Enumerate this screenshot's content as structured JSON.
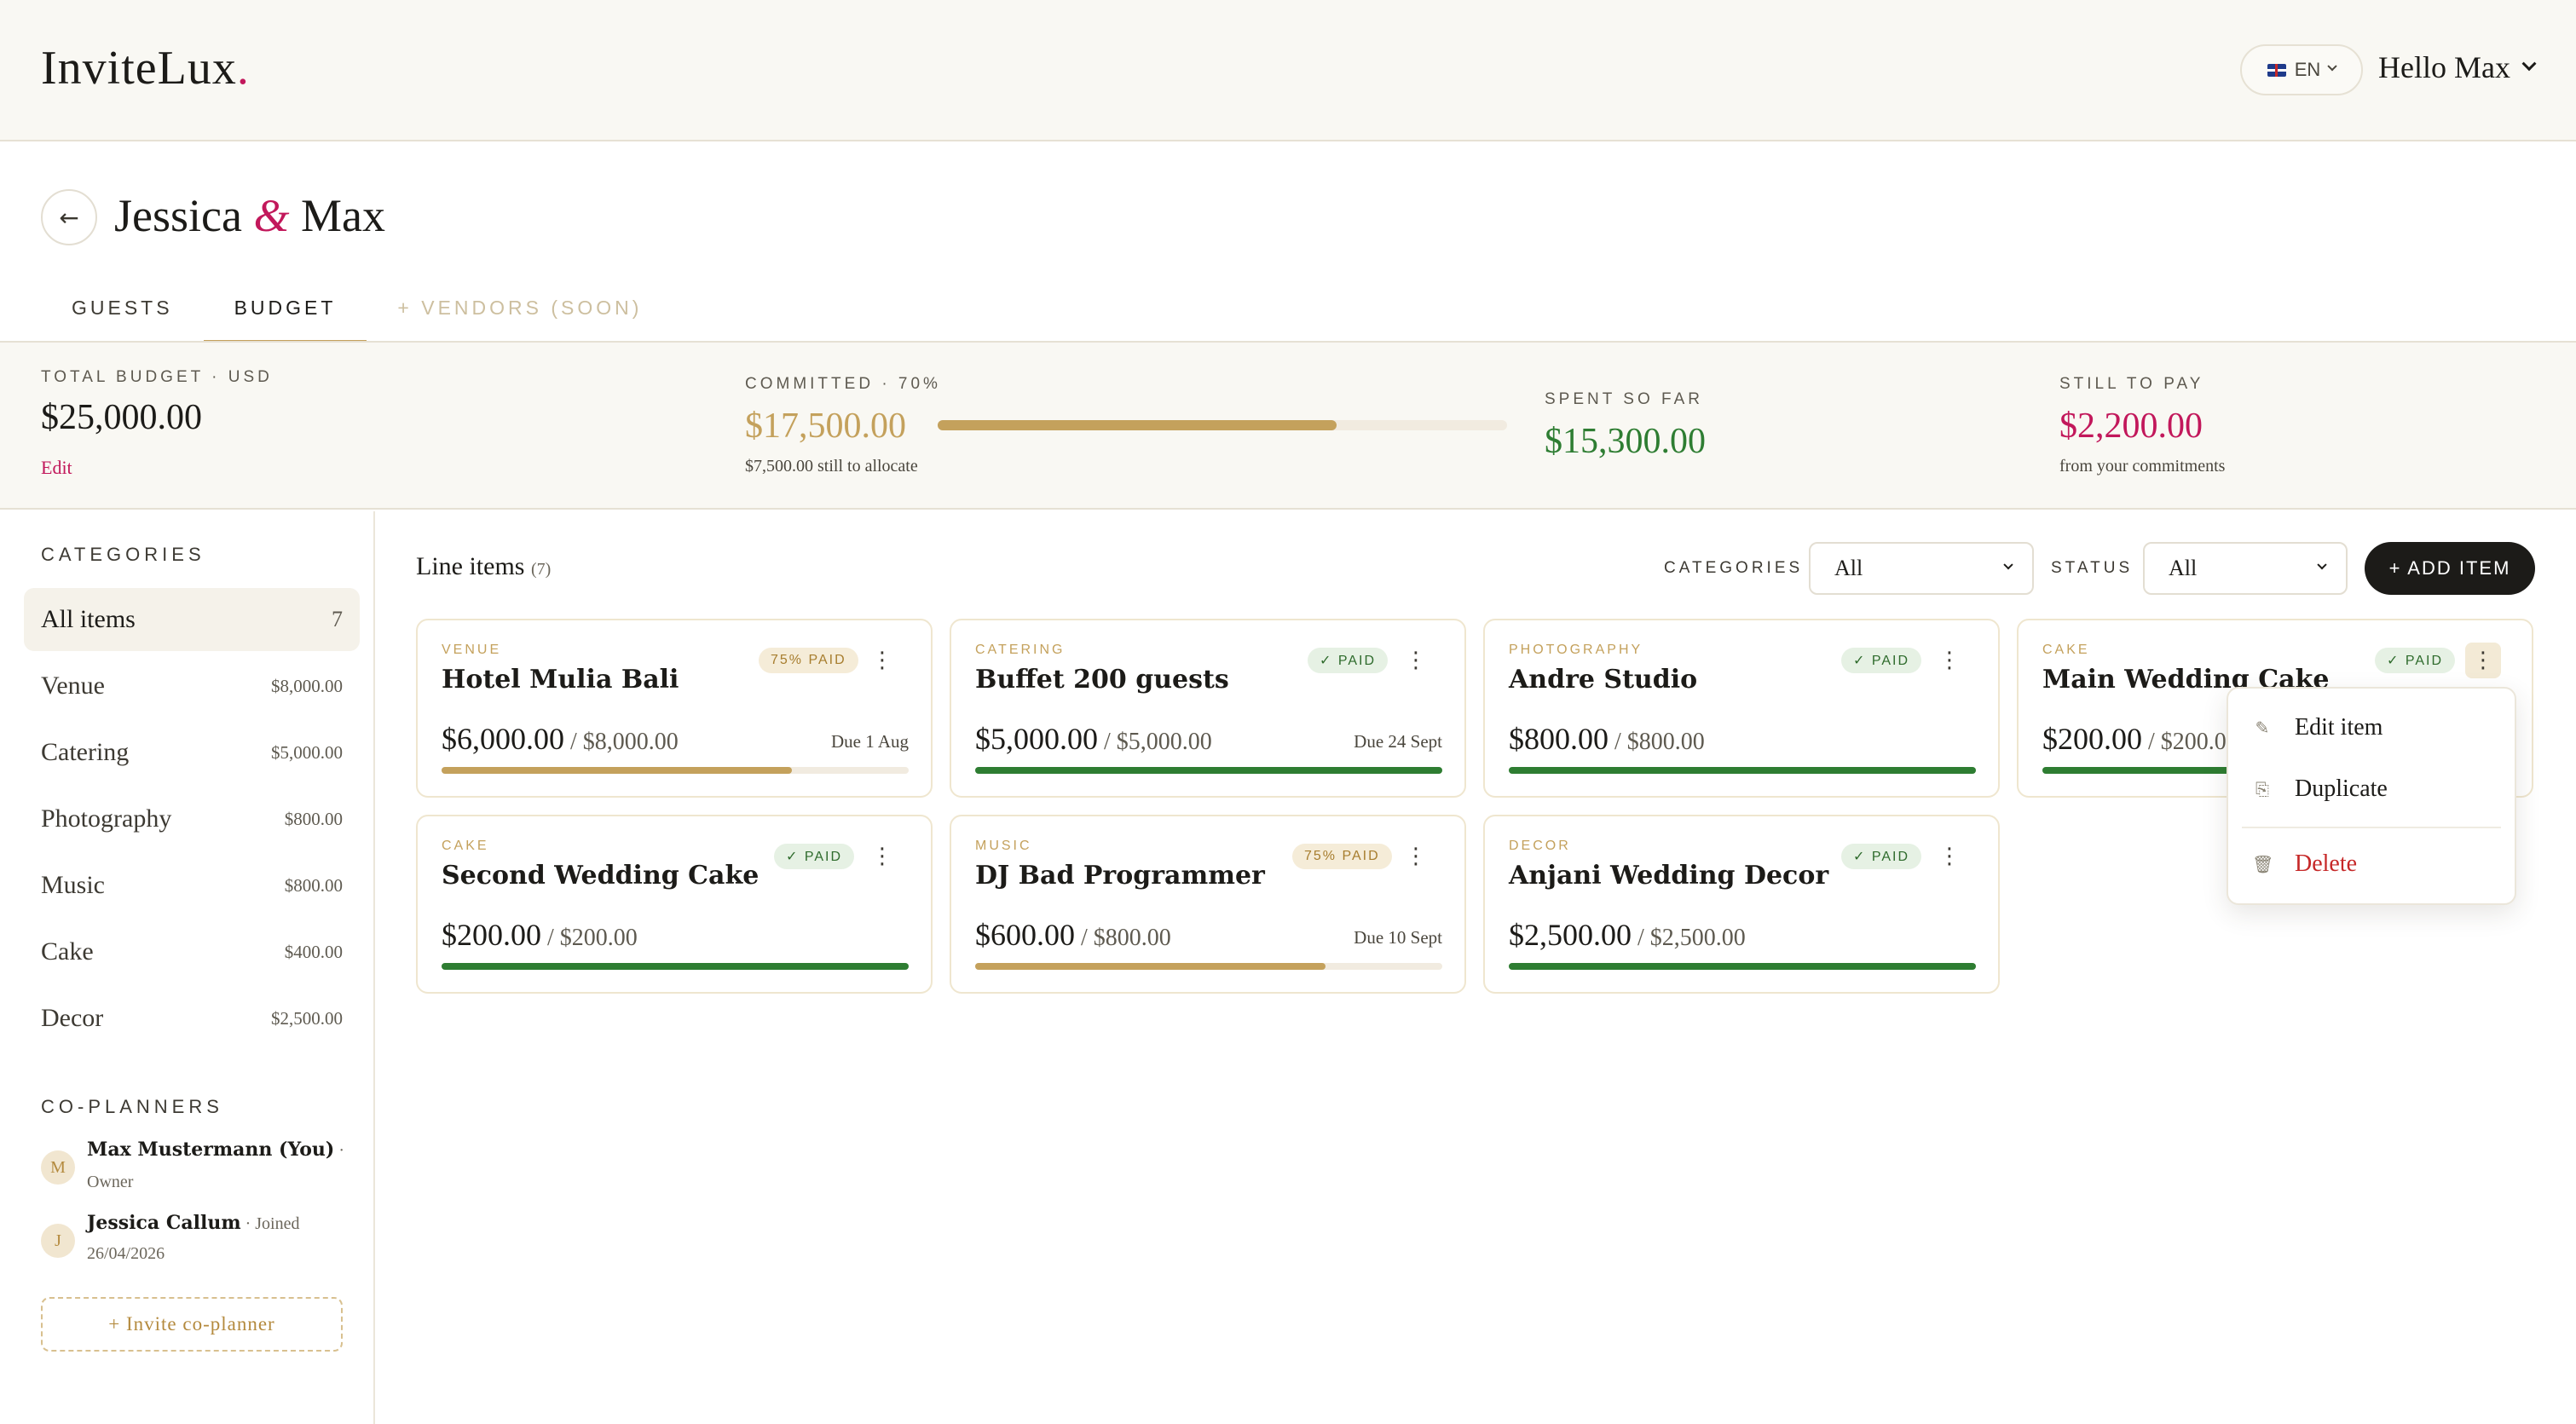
{
  "header": {
    "logo": "InviteLux",
    "logo_dot": ".",
    "lang": "EN",
    "greeting": "Hello Max"
  },
  "event": {
    "name_a": "Jessica",
    "amp": "&",
    "name_b": "Max"
  },
  "tabs": [
    {
      "label": "GUESTS"
    },
    {
      "label": "BUDGET"
    },
    {
      "label": "+ VENDORS (SOON)"
    }
  ],
  "summary": {
    "total_label": "TOTAL BUDGET · USD",
    "total_value": "$25,000.00",
    "edit": "Edit",
    "committed_label": "COMMITTED · 70%",
    "committed_value": "$17,500.00",
    "committed_sub": "$7,500.00 still to allocate",
    "committed_fraction": 0.7,
    "spent_label": "SPENT SO FAR",
    "spent_value": "$15,300.00",
    "topay_label": "STILL TO PAY",
    "topay_value": "$2,200.00",
    "topay_sub": "from your commitments"
  },
  "colors": {
    "accent_gold": "#c4a15c",
    "brand_pink": "#c2185b",
    "paid_green": "#2e7d32",
    "dark": "#1c1b18"
  },
  "sidebar": {
    "categories_heading": "CATEGORIES",
    "categories": [
      {
        "name": "All items",
        "amount": "7"
      },
      {
        "name": "Venue",
        "amount": "$8,000.00"
      },
      {
        "name": "Catering",
        "amount": "$5,000.00"
      },
      {
        "name": "Photography",
        "amount": "$800.00"
      },
      {
        "name": "Music",
        "amount": "$800.00"
      },
      {
        "name": "Cake",
        "amount": "$400.00"
      },
      {
        "name": "Decor",
        "amount": "$2,500.00"
      }
    ],
    "coplanners_heading": "CO-PLANNERS",
    "coplanners": [
      {
        "initial": "M",
        "name": "Max Mustermann (You)",
        "sep": " ·",
        "meta": "Owner"
      },
      {
        "initial": "J",
        "name": "Jessica Callum",
        "meta_inline": " · Joined",
        "meta": "26/04/2026"
      }
    ],
    "invite": "+ Invite co-planner"
  },
  "toolbar": {
    "title": "Line items",
    "count": "(7)",
    "categories_label": "CATEGORIES",
    "categories_value": "All",
    "status_label": "STATUS",
    "status_value": "All",
    "add_button": "+ ADD ITEM"
  },
  "items": [
    {
      "category": "VENUE",
      "name": "Hotel Mulia Bali",
      "badge": "75% PAID",
      "paid": "$6,000.00",
      "sep": " / ",
      "total": "$8,000.00",
      "due": "Due 1 Aug",
      "progress": 0.75
    },
    {
      "category": "CATERING",
      "name": "Buffet 200 guests",
      "badge": "✓ PAID",
      "paid": "$5,000.00",
      "sep": " / ",
      "total": "$5,000.00",
      "due": "Due 24 Sept",
      "progress": 1.0
    },
    {
      "category": "PHOTOGRAPHY",
      "name": "Andre Studio",
      "badge": "✓ PAID",
      "paid": "$800.00",
      "sep": " / ",
      "total": "$800.00",
      "due": "",
      "progress": 1.0
    },
    {
      "category": "CAKE",
      "name": "Main Wedding Cake",
      "badge": "✓ PAID",
      "paid": "$200.00",
      "sep": " / ",
      "total": "$200.00",
      "due": "",
      "progress": 1.0
    },
    {
      "category": "CAKE",
      "name": "Second Wedding Cake",
      "badge": "✓ PAID",
      "paid": "$200.00",
      "sep": " / ",
      "total": "$200.00",
      "due": "",
      "progress": 1.0
    },
    {
      "category": "MUSIC",
      "name": "DJ Bad Programmer",
      "badge": "75% PAID",
      "paid": "$600.00",
      "sep": " / ",
      "total": "$800.00",
      "due": "Due 10 Sept",
      "progress": 0.75
    },
    {
      "category": "DECOR",
      "name": "Anjani Wedding Decor",
      "badge": "✓ PAID",
      "paid": "$2,500.00",
      "sep": " / ",
      "total": "$2,500.00",
      "due": "",
      "progress": 1.0
    }
  ],
  "item_menu": {
    "edit": "Edit item",
    "duplicate": "Duplicate",
    "delete": "Delete"
  },
  "icons": {
    "back": "←",
    "kebab": "⋮",
    "edit": "✎",
    "duplicate": "⎘",
    "delete": "🗑"
  }
}
